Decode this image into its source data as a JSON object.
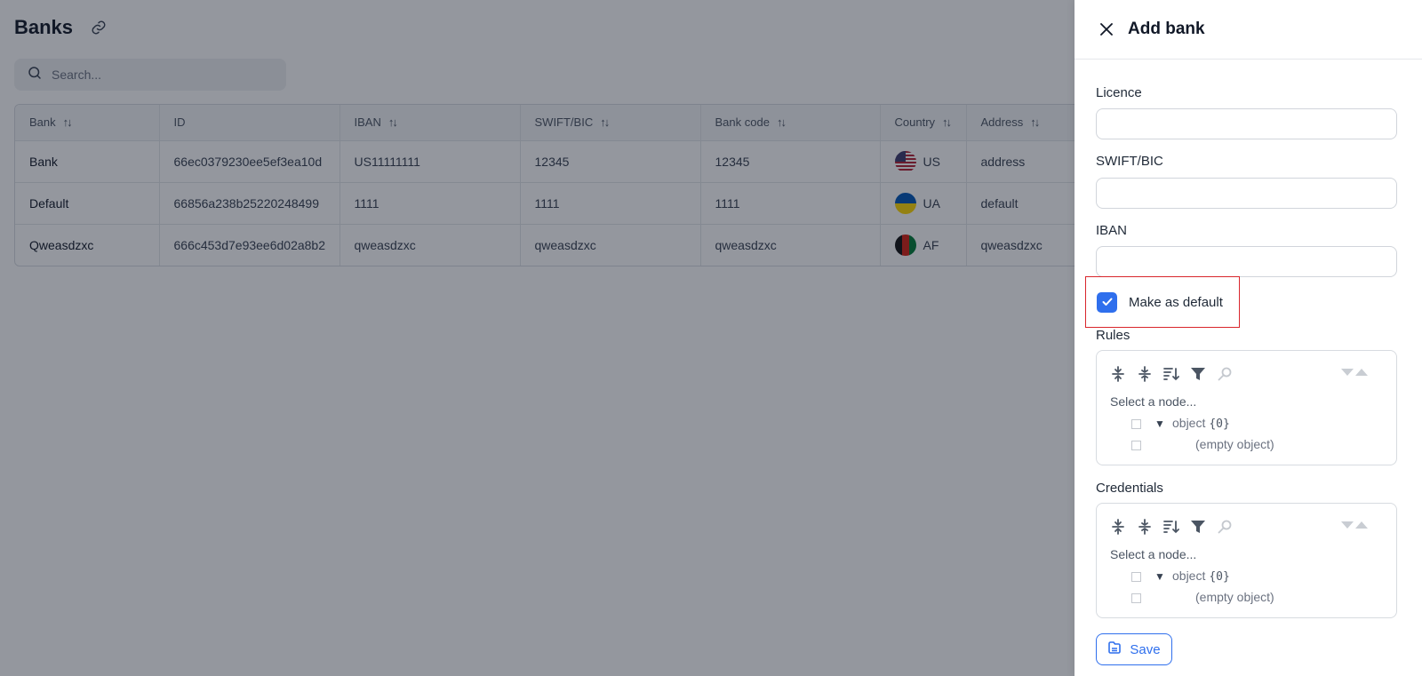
{
  "page": {
    "title": "Banks",
    "search_placeholder": "Search..."
  },
  "table": {
    "columns": [
      "Bank",
      "ID",
      "IBAN",
      "SWIFT/BIC",
      "Bank code",
      "Country",
      "Address"
    ],
    "sortable": [
      true,
      false,
      true,
      true,
      true,
      true,
      true
    ],
    "rows": [
      {
        "bank": "Bank",
        "id": "66ec0379230ee5ef3ea10d",
        "iban": "US11111111",
        "swift": "12345",
        "bank_code": "12345",
        "country": "US",
        "address": "address"
      },
      {
        "bank": "Default",
        "id": "66856a238b25220248499",
        "iban": "1111",
        "swift": "1111",
        "bank_code": "1111",
        "country": "UA",
        "address": "default"
      },
      {
        "bank": "Qweasdzxc",
        "id": "666c453d7e93ee6d02a8b2",
        "iban": "qweasdzxc",
        "swift": "qweasdzxc",
        "bank_code": "qweasdzxc",
        "country": "AF",
        "address": "qweasdzxc"
      }
    ]
  },
  "drawer": {
    "title": "Add bank",
    "fields": {
      "licence_label": "Licence",
      "licence_value": "",
      "swift_label": "SWIFT/BIC",
      "swift_value": "",
      "iban_label": "IBAN",
      "iban_value": ""
    },
    "make_default": {
      "label": "Make as default",
      "checked": true
    },
    "rules": {
      "label": "Rules",
      "select_text": "Select a node...",
      "root_key": "object",
      "root_count": "{0}",
      "empty_text": "(empty object)"
    },
    "credentials": {
      "label": "Credentials",
      "select_text": "Select a node...",
      "root_key": "object",
      "root_count": "{0}",
      "empty_text": "(empty object)"
    },
    "save_label": "Save"
  },
  "colors": {
    "accent": "#2f6fed",
    "highlight_border": "#d9262c",
    "overlay": "rgba(17,24,39,0.45)"
  }
}
